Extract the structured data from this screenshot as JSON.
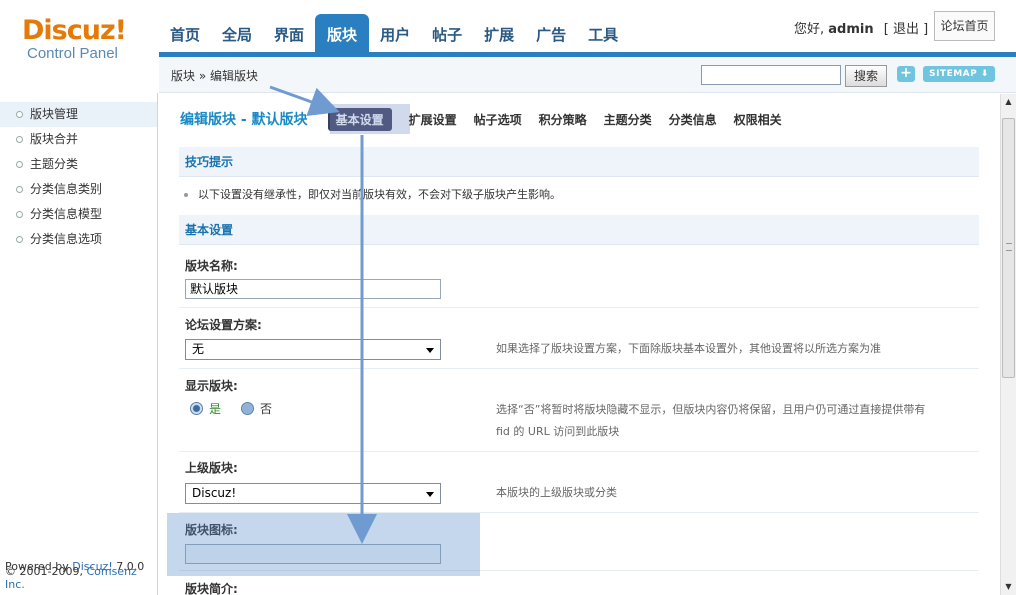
{
  "logo": {
    "main": "Discuz!",
    "sub": "Control Panel"
  },
  "nav": {
    "tabs": [
      {
        "label": "首页"
      },
      {
        "label": "全局"
      },
      {
        "label": "界面"
      },
      {
        "label": "版块"
      },
      {
        "label": "用户"
      },
      {
        "label": "帖子"
      },
      {
        "label": "扩展"
      },
      {
        "label": "广告"
      },
      {
        "label": "工具"
      }
    ],
    "active_index": 3
  },
  "user": {
    "greeting": "您好,",
    "name": "admin",
    "logout": "[ 退出 ]",
    "home_button": "论坛首页"
  },
  "crumb": {
    "text": "版块 » 编辑版块"
  },
  "search": {
    "value": "",
    "button": "搜索"
  },
  "toolbar": {
    "plus": "+",
    "sitemap": "SITEMAP ⬇"
  },
  "sidebar": {
    "items": [
      {
        "label": "版块管理"
      },
      {
        "label": "版块合并"
      },
      {
        "label": "主题分类"
      },
      {
        "label": "分类信息类别"
      },
      {
        "label": "分类信息模型"
      },
      {
        "label": "分类信息选项"
      }
    ],
    "active_index": 0,
    "powered": {
      "prefix": "Powered by ",
      "link": "Discuz!",
      "version": " 7.0.0"
    },
    "copyright": {
      "prefix": "© 2001-2009, ",
      "link": "Comsenz Inc."
    }
  },
  "main": {
    "title": "编辑版块 - 默认版块",
    "subtabs": [
      {
        "label": "基本设置"
      },
      {
        "label": "扩展设置"
      },
      {
        "label": "帖子选项"
      },
      {
        "label": "积分策略"
      },
      {
        "label": "主题分类"
      },
      {
        "label": "分类信息"
      },
      {
        "label": "权限相关"
      }
    ],
    "tips_header": "技巧提示",
    "tip": "以下设置没有继承性，即仅对当前版块有效，不会对下级子版块产生影响。",
    "basic_header": "基本设置",
    "forum_name_label": "版块名称:",
    "forum_name_value": "默认版块",
    "scheme_label": "论坛设置方案:",
    "scheme_value": "无",
    "scheme_hint": "如果选择了版块设置方案，下面除版块基本设置外，其他设置将以所选方案为准",
    "show_label": "显示版块:",
    "show_yes": "是",
    "show_no": "否",
    "show_hint_1": "选择“否”将暂时将版块隐藏不显示，但版块内容仍将保留，且用户仍可通过直接提供带有",
    "show_hint_2": "fid 的 URL 访问到此版块",
    "parent_label": "上级版块:",
    "parent_value": "Discuz!",
    "parent_hint": "本版块的上级版块或分类",
    "icon_label": "版块图标:",
    "icon_value": "",
    "desc_label": "版块简介:"
  },
  "colors": {
    "brand_orange": "#e37a0a",
    "nav_blue": "#2a7fc0",
    "title_blue": "#1a8ac6",
    "annotation_blue": "#6f9bd1"
  }
}
